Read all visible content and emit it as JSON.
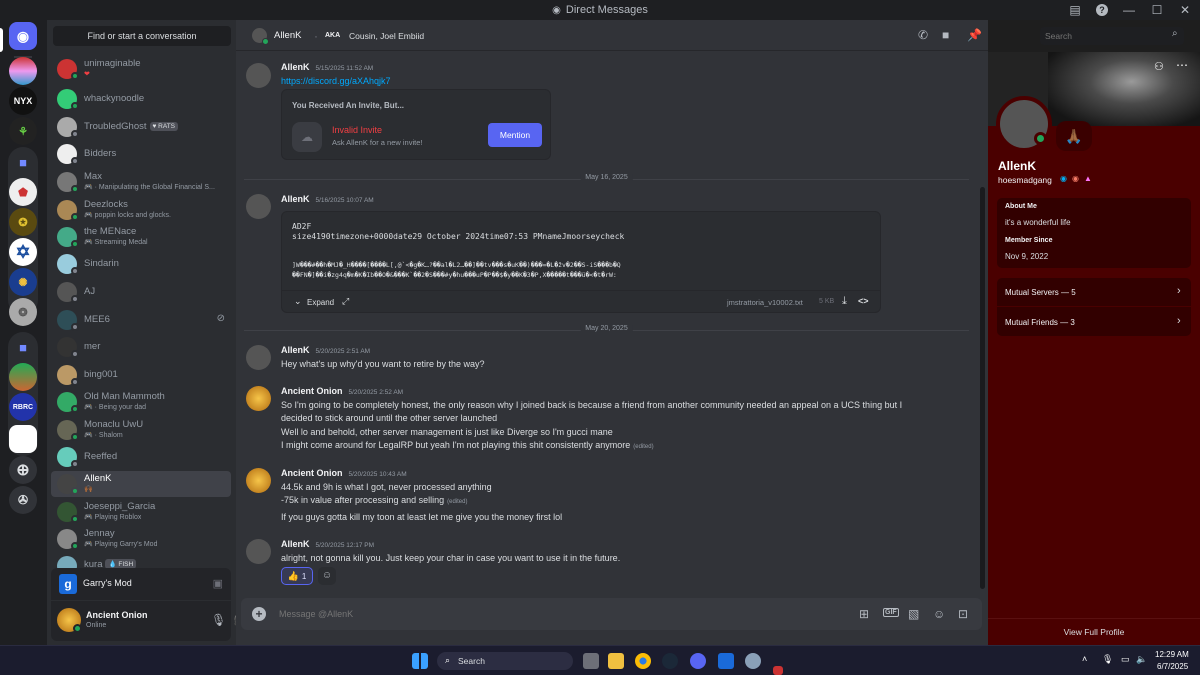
{
  "window": {
    "title": "Direct Messages"
  },
  "dms": {
    "search_label": "Find or start a conversation",
    "items": [
      {
        "name": "unimaginable",
        "sub": "❤",
        "status": "#23a55a"
      },
      {
        "name": "whackynoodle",
        "sub": "",
        "status": "#23a55a"
      },
      {
        "name": "TroubledGhost",
        "tag": "♥ RATS",
        "sub": "",
        "status": "#80848e"
      },
      {
        "name": "Bidders",
        "sub": "",
        "status": "#80848e"
      },
      {
        "name": "Max",
        "sub": "🎮 · Manipulating the Global Financial S...",
        "status": "#23a55a"
      },
      {
        "name": "Deezlocks",
        "sub": "🎮 poppin locks and glocks.",
        "status": "#23a55a"
      },
      {
        "name": "the MENace",
        "sub": "🎮 Streaming Medal",
        "status": "#23a55a"
      },
      {
        "name": "Sindarin",
        "sub": "",
        "status": "#80848e"
      },
      {
        "name": "AJ",
        "sub": "",
        "status": "#80848e"
      },
      {
        "name": "MEE6",
        "sub": "",
        "status": "#80848e"
      },
      {
        "name": "mer",
        "sub": "",
        "status": "#80848e"
      },
      {
        "name": "bing001",
        "sub": "",
        "status": "#80848e"
      },
      {
        "name": "Old Man Mammoth",
        "sub": "🎮 · Being your dad",
        "status": "#23a55a"
      },
      {
        "name": "Monaclu UwU",
        "sub": "🎮 · Shalom",
        "status": "#23a55a"
      },
      {
        "name": "Reeffed",
        "sub": "",
        "status": "#80848e"
      },
      {
        "name": "AllenK",
        "sub": "🙌🏾",
        "status": "#23a55a"
      },
      {
        "name": "Joeseppi_Garcia",
        "sub": "🎮 Playing Roblox",
        "status": "#23a55a"
      },
      {
        "name": "Jennay",
        "sub": "🎮 Playing Garry's Mod",
        "status": "#23a55a"
      },
      {
        "name": "kura",
        "tag": "💧 FISH",
        "sub": "",
        "status": "#23a55a"
      }
    ],
    "activity": "Garry's Mod",
    "user": {
      "name": "Ancient Onion",
      "status": "Online"
    }
  },
  "guilds": {
    "nyx": "NYX",
    "fdl": "RBRC"
  },
  "header": {
    "name": "AllenK",
    "aka_label": "AKA",
    "aka": "Cousin, Joel Embiid",
    "search_placeholder": "Search"
  },
  "messages": {
    "m1": {
      "author": "AllenK",
      "ts": "5/15/2025 11:52 AM",
      "link": "https://discord.gg/aXAhqjk7",
      "invite": {
        "heading": "You Received An Invite, But...",
        "title": "Invalid Invite",
        "desc": "Ask AllenK for a new invite!",
        "button": "Mention"
      }
    },
    "div1": "May 16, 2025",
    "m2": {
      "author": "AllenK",
      "ts": "5/16/2025 10:07 AM",
      "code1": "AD2F",
      "code2": "size4190timezone+0000date29 October 2024time07:53 PMnameJmoorseycheck",
      "code3": "]W���#��h�MJ�_H����[����L[,@`<�g�K…?��al�L2…��]��tv���s�uK��)���=�L�žv�2��S-iS���b�Q",
      "code4": "��FN�]��i�zg4q�m�K�Ib��O�&���K`��2�S���#y�hu���uP�P��$�y��K�3�P,X�����t���ü�<�t�rW:",
      "expand": "Expand",
      "file": "jmstrattoria_v10002.txt",
      "size": "5 KB"
    },
    "div2": "May 20, 2025",
    "m3": {
      "author": "AllenK",
      "ts": "5/20/2025 2:51 AM",
      "text": "Hey what's up why'd you want to retire by the way?"
    },
    "m4": {
      "author": "Ancient Onion",
      "ts": "5/20/2025 2:52 AM",
      "l1": "So I'm going to be completely honest, the only reason why I joined back is because a friend from another community needed an appeal on a UCS thing but I",
      "l2": "decided to stick around until the other server launched",
      "l3": "Well lo and behold, other server management is just like Diverge so I'm gucci mane",
      "l4": "I might come around for LegalRP but yeah I'm not playing this shit consistently anymore",
      "edited": "(edited)"
    },
    "m5": {
      "author": "Ancient Onion",
      "ts": "5/20/2025 10:43 AM",
      "l1": "44.5k and 9h is what I got, never processed anything",
      "l2": "-75k in value after processing and selling",
      "edited": "(edited)",
      "l3": "If you guys gotta kill my toon at least let me give you the money first lol"
    },
    "m6": {
      "author": "AllenK",
      "ts": "5/20/2025 12:17 PM",
      "text": "alright, not gonna kill you. Just keep your char in case you want to use it in the future.",
      "reaction": "👍",
      "reaction_count": "1"
    }
  },
  "composer": {
    "placeholder": "Message @AllenK"
  },
  "profile": {
    "name": "AllenK",
    "username": "hoesmadgang",
    "about_label": "About Me",
    "about": "it's a wonderful life",
    "since_label": "Member Since",
    "since": "Nov 9, 2022",
    "mutual_servers": "Mutual Servers — 5",
    "mutual_friends": "Mutual Friends — 3",
    "view_full": "View Full Profile"
  },
  "taskbar": {
    "search": "Search",
    "time": "12:29 AM",
    "date": "6/7/2025"
  },
  "colors": {
    "online": "#23a55a",
    "blurple": "#5865f2",
    "profile_bg": "#4a0000",
    "invalid": "#f23f43"
  }
}
